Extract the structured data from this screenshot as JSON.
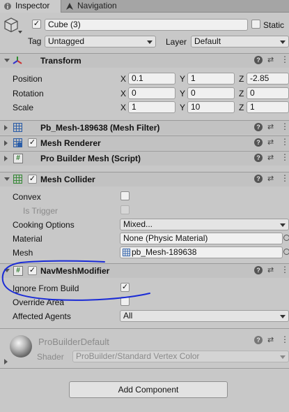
{
  "tabs": [
    {
      "label": "Inspector",
      "icon": "inspector-icon"
    },
    {
      "label": "Navigation",
      "icon": "navigation-icon"
    }
  ],
  "object": {
    "name": "Cube (3)",
    "active": true,
    "static_label": "Static",
    "tag_label": "Tag",
    "tag_value": "Untagged",
    "layer_label": "Layer",
    "layer_value": "Default"
  },
  "transform": {
    "title": "Transform",
    "rows": [
      {
        "label": "Position",
        "x": "0.1",
        "y": "1",
        "z": "-2.85"
      },
      {
        "label": "Rotation",
        "x": "0",
        "y": "0",
        "z": "0"
      },
      {
        "label": "Scale",
        "x": "1",
        "y": "10",
        "z": "1"
      }
    ],
    "axis": {
      "x": "X",
      "y": "Y",
      "z": "Z"
    }
  },
  "mesh_filter": {
    "title": "Pb_Mesh-189638 (Mesh Filter)"
  },
  "mesh_renderer": {
    "title": "Mesh Renderer"
  },
  "pro_builder_mesh": {
    "title": "Pro Builder Mesh (Script)"
  },
  "mesh_collider": {
    "title": "Mesh Collider",
    "convex_label": "Convex",
    "is_trigger_label": "Is Trigger",
    "cooking_label": "Cooking Options",
    "cooking_value": "Mixed...",
    "material_label": "Material",
    "material_value": "None (Physic Material)",
    "mesh_label": "Mesh",
    "mesh_value": "pb_Mesh-189638"
  },
  "navmesh_modifier": {
    "title": "NavMeshModifier",
    "ignore_label": "Ignore From Build",
    "ignore_checked": "✓",
    "override_label": "Override Area",
    "agents_label": "Affected Agents",
    "agents_value": "All"
  },
  "material": {
    "name": "ProBuilderDefault",
    "shader_label": "Shader",
    "shader_value": "ProBuilder/Standard Vertex Color"
  },
  "add_component": {
    "label": "Add Component"
  },
  "colors": {
    "annotation": "#1a2bd6",
    "background": "#c8c8c8"
  }
}
